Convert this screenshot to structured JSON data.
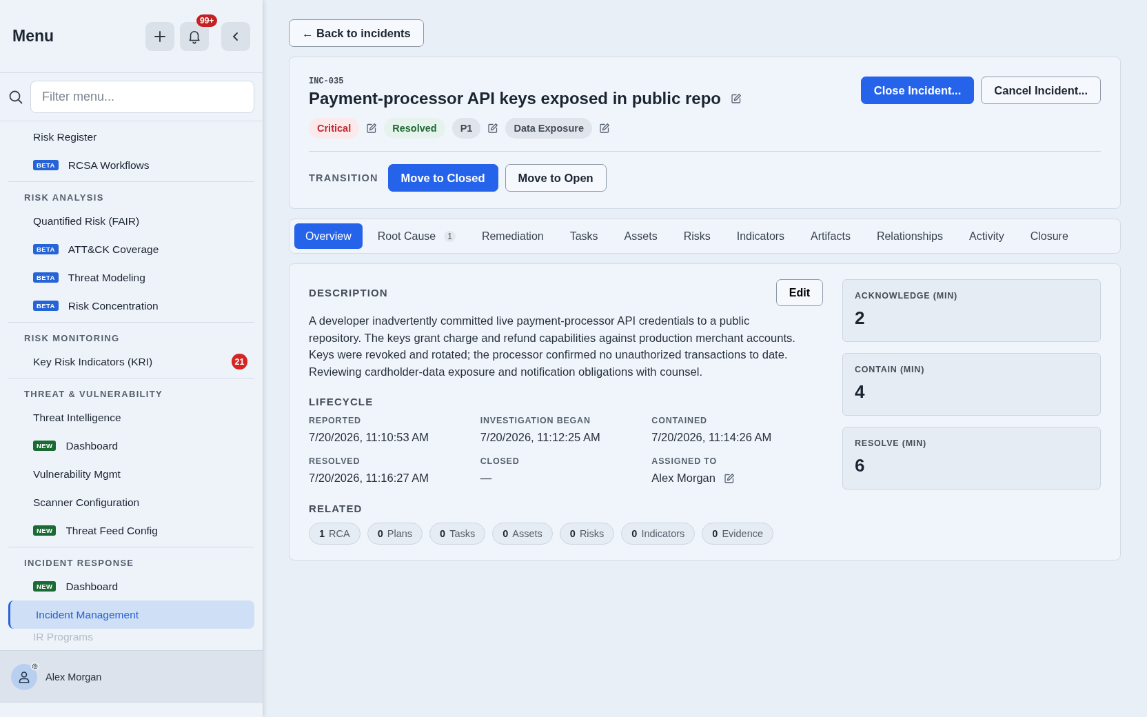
{
  "sidebar": {
    "title": "Menu",
    "notification_count": "99+",
    "filter": {
      "placeholder": "Filter menu..."
    },
    "sections": [
      {
        "items": [
          {
            "label": "Risk Register",
            "selected": false
          },
          {
            "label": "RCSA Workflows",
            "tag": {
              "text": "BETA",
              "kind": "beta"
            },
            "selected": false
          }
        ]
      },
      {
        "heading": "RISK ANALYSIS",
        "items": [
          {
            "label": "Quantified Risk (FAIR)",
            "selected": false
          },
          {
            "label": "ATT&CK Coverage",
            "tag": {
              "text": "BETA",
              "kind": "beta"
            },
            "selected": false
          },
          {
            "label": "Threat Modeling",
            "tag": {
              "text": "BETA",
              "kind": "beta"
            },
            "selected": false
          },
          {
            "label": "Risk Concentration",
            "tag": {
              "text": "BETA",
              "kind": "beta"
            },
            "selected": false
          }
        ]
      },
      {
        "heading": "RISK MONITORING",
        "items": [
          {
            "label": "Key Risk Indicators (KRI)",
            "count": "21",
            "selected": false
          }
        ]
      },
      {
        "heading": "THREAT & VULNERABILITY",
        "items": [
          {
            "label": "Threat Intelligence",
            "selected": false
          },
          {
            "label": "Dashboard",
            "tag": {
              "text": "NEW",
              "kind": "new"
            },
            "selected": false
          },
          {
            "label": "Vulnerability Mgmt",
            "selected": false
          },
          {
            "label": "Scanner Configuration",
            "selected": false
          },
          {
            "label": "Threat Feed Config",
            "tag": {
              "text": "NEW",
              "kind": "new"
            },
            "selected": false
          }
        ]
      },
      {
        "heading": "INCIDENT RESPONSE",
        "items": [
          {
            "label": "Dashboard",
            "tag": {
              "text": "NEW",
              "kind": "new"
            },
            "selected": false
          },
          {
            "label": "Incident Management",
            "selected": true
          },
          {
            "label": "IR Programs",
            "selected": false,
            "faded": true
          }
        ]
      }
    ],
    "user": {
      "name": "Alex Morgan"
    }
  },
  "back_button": "← Back to incidents",
  "incident": {
    "id": "INC-035",
    "title": "Payment-processor API keys exposed in public repo",
    "chips": [
      {
        "label": "Critical",
        "kind": "severity",
        "editable": true
      },
      {
        "label": "Resolved",
        "kind": "status",
        "editable": false
      },
      {
        "label": "P1",
        "kind": "priority",
        "editable": true
      },
      {
        "label": "Data Exposure",
        "kind": "category",
        "editable": true
      }
    ],
    "actions": [
      {
        "label": "Close Incident...",
        "kind": "primary"
      },
      {
        "label": "Cancel Incident...",
        "kind": "secondary"
      }
    ],
    "transition": {
      "label": "TRANSITION",
      "buttons": [
        {
          "label": "Move to Closed",
          "kind": "primary"
        },
        {
          "label": "Move to Open",
          "kind": "secondary"
        }
      ]
    }
  },
  "tabs": [
    {
      "label": "Overview",
      "selected": true
    },
    {
      "label": "Root Cause",
      "count": "1",
      "selected": false
    },
    {
      "label": "Remediation",
      "selected": false
    },
    {
      "label": "Tasks",
      "selected": false
    },
    {
      "label": "Assets",
      "selected": false
    },
    {
      "label": "Risks",
      "selected": false
    },
    {
      "label": "Indicators",
      "selected": false
    },
    {
      "label": "Artifacts",
      "selected": false
    },
    {
      "label": "Relationships",
      "selected": false
    },
    {
      "label": "Activity",
      "selected": false
    },
    {
      "label": "Closure",
      "selected": false
    }
  ],
  "overview": {
    "description": {
      "heading": "DESCRIPTION",
      "edit_button": "Edit",
      "text": "A developer inadvertently committed live payment-processor API credentials to a public repository. The keys grant charge and refund capabilities against production merchant accounts. Keys were revoked and rotated; the processor confirmed no unauthorized transactions to date. Reviewing cardholder-data exposure and notification obligations with counsel."
    },
    "lifecycle": {
      "heading": "LIFECYCLE",
      "fields": [
        {
          "label": "REPORTED",
          "value": "7/20/2026, 11:10:53 AM",
          "editable": false
        },
        {
          "label": "INVESTIGATION BEGAN",
          "value": "7/20/2026, 11:12:25 AM",
          "editable": false
        },
        {
          "label": "CONTAINED",
          "value": "7/20/2026, 11:14:26 AM",
          "editable": false
        },
        {
          "label": "RESOLVED",
          "value": "7/20/2026, 11:16:27 AM",
          "editable": false
        },
        {
          "label": "CLOSED",
          "value": "—",
          "editable": false
        },
        {
          "label": "ASSIGNED TO",
          "value": "Alex Morgan",
          "editable": true
        }
      ]
    },
    "related": {
      "heading": "RELATED",
      "chips": [
        {
          "count": "1",
          "label": "RCA"
        },
        {
          "count": "0",
          "label": "Plans"
        },
        {
          "count": "0",
          "label": "Tasks"
        },
        {
          "count": "0",
          "label": "Assets"
        },
        {
          "count": "0",
          "label": "Risks"
        },
        {
          "count": "0",
          "label": "Indicators"
        },
        {
          "count": "0",
          "label": "Evidence"
        }
      ]
    },
    "metrics": [
      {
        "label": "ACKNOWLEDGE (MIN)",
        "value": "2"
      },
      {
        "label": "CONTAIN (MIN)",
        "value": "4"
      },
      {
        "label": "RESOLVE (MIN)",
        "value": "6"
      }
    ]
  }
}
